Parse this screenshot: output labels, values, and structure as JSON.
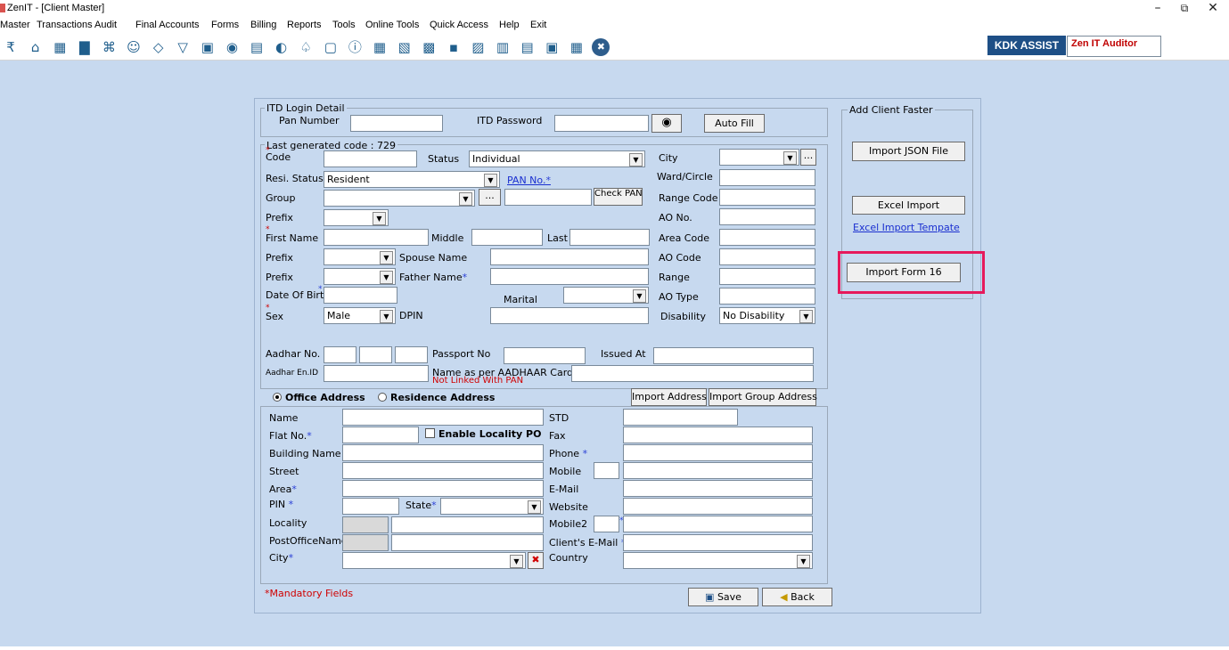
{
  "window": {
    "title": "ZenIT - [Client Master]",
    "minimize": "–",
    "maximize": "⧉",
    "close": "✕"
  },
  "menu": [
    "Master",
    "Transactions",
    "Audit",
    "Final Accounts",
    "Forms",
    "Billing",
    "Reports",
    "Tools",
    "Online Tools",
    "Quick Access",
    "Help",
    "Exit"
  ],
  "toolbar_icons": [
    "rupee-icon",
    "home-icon",
    "grid-icon",
    "bar-chart-icon",
    "gift-icon",
    "group-icon",
    "tag-icon",
    "filter-icon",
    "tax-icon",
    "eye-icon",
    "calculator-icon",
    "pie-icon",
    "pay-icon",
    "document-icon",
    "info-icon",
    "calc2-icon",
    "export-icon",
    "calendar-icon",
    "pc-icon",
    "form-icon",
    "bs-icon",
    "building-icon",
    "scd-icon",
    "notes-icon",
    "close-circle-icon"
  ],
  "toolbar_glyphs": [
    "₹",
    "⌂",
    "▦",
    "▇",
    "⌘",
    "☺",
    "◇",
    "▽",
    "▣",
    "◉",
    "▤",
    "◐",
    "♤",
    "▢",
    "ⓘ",
    "▦",
    "▧",
    "▩",
    "▪",
    "▨",
    "▥",
    "▤",
    "▣",
    "▦",
    "✖"
  ],
  "brand": {
    "kdk": "KDK ASSIST",
    "zen": "Zen IT Auditor"
  },
  "itd": {
    "legend": "ITD Login Detail",
    "pan_label": "Pan Number",
    "pan_value": "",
    "pwd_label": "ITD Password",
    "pwd_value": "",
    "autofill": "Auto Fill"
  },
  "client": {
    "legend": "Last generated code : 729",
    "code_label": "Code",
    "code_value": "",
    "status_label": "Status",
    "status_value": "Individual",
    "city_label": "City",
    "city_value": "",
    "more": "...",
    "resi_label": "Resi. Status",
    "resi_value": "Resident",
    "pan_label": "PAN No.",
    "pan_star": "*",
    "ward_label": "Ward/Circle",
    "group_label": "Group",
    "group_value": "",
    "check_pan": "Check PAN",
    "range_code_label": "Range Code",
    "prefix_label": "Prefix",
    "ao_no_label": "AO No.",
    "first_name_label": "First Name",
    "middle_label": "Middle",
    "last_label": "Last",
    "area_code_label": "Area Code",
    "spouse_label": "Spouse Name",
    "ao_code_label": "AO Code",
    "father_label": "Father Name",
    "range_label": "Range",
    "dob_label": "Date Of Birth",
    "marital_label": "Marital",
    "ao_type_label": "AO Type",
    "sex_label": "Sex",
    "sex_value": "Male",
    "dpin_label": "DPIN",
    "disability_label": "Disability",
    "disability_value": "No Disability",
    "aadhar_label": "Aadhar No.",
    "passport_label": "Passport No",
    "issued_label": "Issued At",
    "aadhar_en_label": "Aadhar En.ID",
    "name_aadhar_label": "Name as per AADHAAR Card",
    "not_linked": "Not Linked With PAN"
  },
  "address": {
    "office": "Office Address",
    "residence": "Residence Address",
    "import_address": "Import Address",
    "import_group": "Import Group Address",
    "name": "Name",
    "flat": "Flat No.",
    "enable_locality": "Enable Locality PO",
    "building": "Building Name",
    "street": "Street",
    "area": "Area",
    "pin": "PIN",
    "state": "State",
    "locality": "Locality",
    "post_office": "PostOfficeName",
    "city": "City",
    "std": "STD",
    "fax": "Fax",
    "phone": "Phone",
    "mobile": "Mobile",
    "email": "E-Mail",
    "website": "Website",
    "mobile2": "Mobile2",
    "client_email": "Client's E-Mail",
    "country": "Country"
  },
  "footer": {
    "mandatory": "*Mandatory Fields",
    "save": "Save",
    "back": "Back"
  },
  "quick": {
    "legend": "Add Client Faster",
    "import_json": "Import JSON File",
    "excel_import": "Excel Import",
    "excel_template": "Excel Import Tempate",
    "import_form16": "Import Form 16"
  },
  "colors": {
    "background": "#c7d9ef",
    "brand": "#1e4f86",
    "highlight": "#e6195b",
    "required": "#2a3fd6",
    "warning": "#d00000"
  }
}
